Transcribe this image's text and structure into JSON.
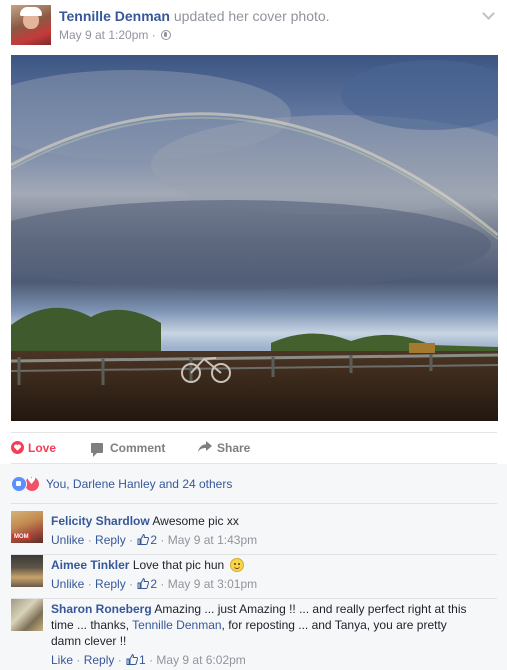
{
  "post": {
    "author": "Tennille Denman",
    "action": "updated her cover photo.",
    "timestamp": "May 9 at 1:20pm",
    "separator": "·",
    "privacy_icon": "globe-icon",
    "menu_icon": "chevron-down-icon"
  },
  "actions": {
    "love_label": "Love",
    "comment_label": "Comment",
    "share_label": "Share"
  },
  "reactions": {
    "icons": [
      "like-reaction-icon",
      "love-reaction-icon"
    ],
    "summary": "You, Darlene Hanley and 24 others"
  },
  "comments": [
    {
      "name": "Felicity Shardlow",
      "text": "Awesome pic xx",
      "avatar_tag": "MOM",
      "reply_action": "Unlike",
      "reply_label": "Reply",
      "likes": "2",
      "time": "May 9 at 1:43pm"
    },
    {
      "name": "Aimee Tinkler",
      "text": "Love that pic hun",
      "emoji": "smile-emoji-icon",
      "reply_action": "Unlike",
      "reply_label": "Reply",
      "likes": "2",
      "time": "May 9 at 3:01pm"
    },
    {
      "name": "Sharon Roneberg",
      "text_part1": "Amazing ... just Amazing !! ... and really perfect right at this time ... thanks,",
      "mention": "Tennille Denman",
      "text_part2": ", for reposting ... and Tanya, you are pretty damn clever !!",
      "reply_action": "Like",
      "reply_label": "Reply",
      "likes": "1",
      "time": "May 9 at 6:02pm"
    }
  ],
  "colors": {
    "link": "#365899",
    "meta": "#90949c",
    "love": "#f33e58",
    "like_blue": "#5890ff"
  }
}
